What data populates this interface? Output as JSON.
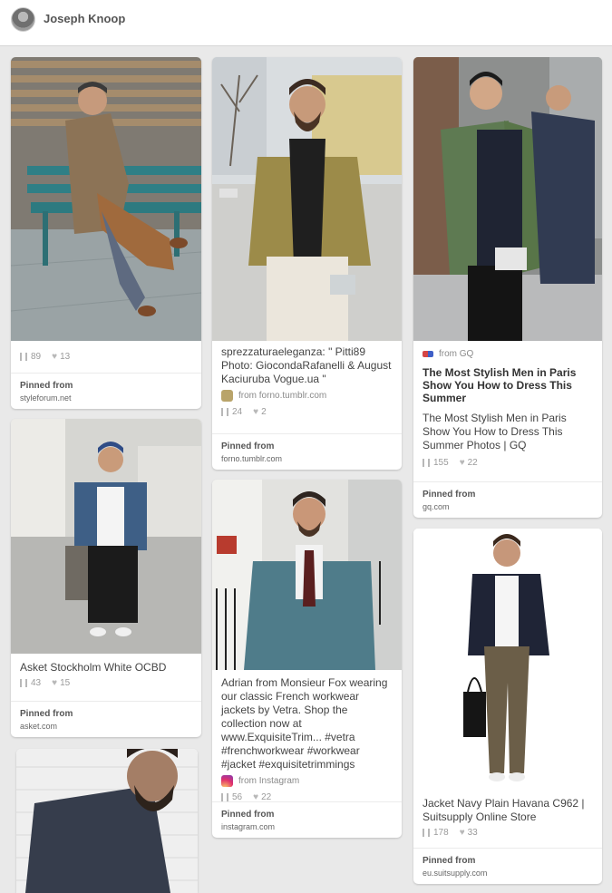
{
  "header": {
    "user_name": "Joseph Knoop"
  },
  "pinned_from_label": "Pinned from",
  "pins": [
    {
      "repins": "89",
      "likes": "13",
      "domain": "styleforum.net"
    },
    {
      "description": "sprezzaturaeleganza: \" Pitti89 Photo: GiocondaRafanelli & August Kaciuruba Vogue.ua \"",
      "source": "from forno.tumblr.com",
      "repins": "24",
      "likes": "2",
      "domain": "forno.tumblr.com"
    },
    {
      "source": "from GQ",
      "title": "The Most Stylish Men in Paris Show You How to Dress This Summer",
      "description": "The Most Stylish Men in Paris Show You How to Dress This Summer Photos | GQ",
      "repins": "155",
      "likes": "22",
      "domain": "gq.com"
    },
    {
      "description": "Asket Stockholm White OCBD",
      "repins": "43",
      "likes": "15",
      "domain": "asket.com"
    },
    {
      "description": "Adrian from Monsieur Fox wearing our classic French workwear jackets by Vetra. Shop the collection now at www.ExquisiteTrim... #vetra #frenchworkwear #workwear #jacket #exquisitetrimmings",
      "source": "from Instagram",
      "repins": "56",
      "likes": "22",
      "domain": "instagram.com"
    },
    {
      "description": "Jacket Navy Plain Havana C962 | Suitsupply Online Store",
      "repins": "178",
      "likes": "33",
      "domain": "eu.suitsupply.com"
    }
  ]
}
